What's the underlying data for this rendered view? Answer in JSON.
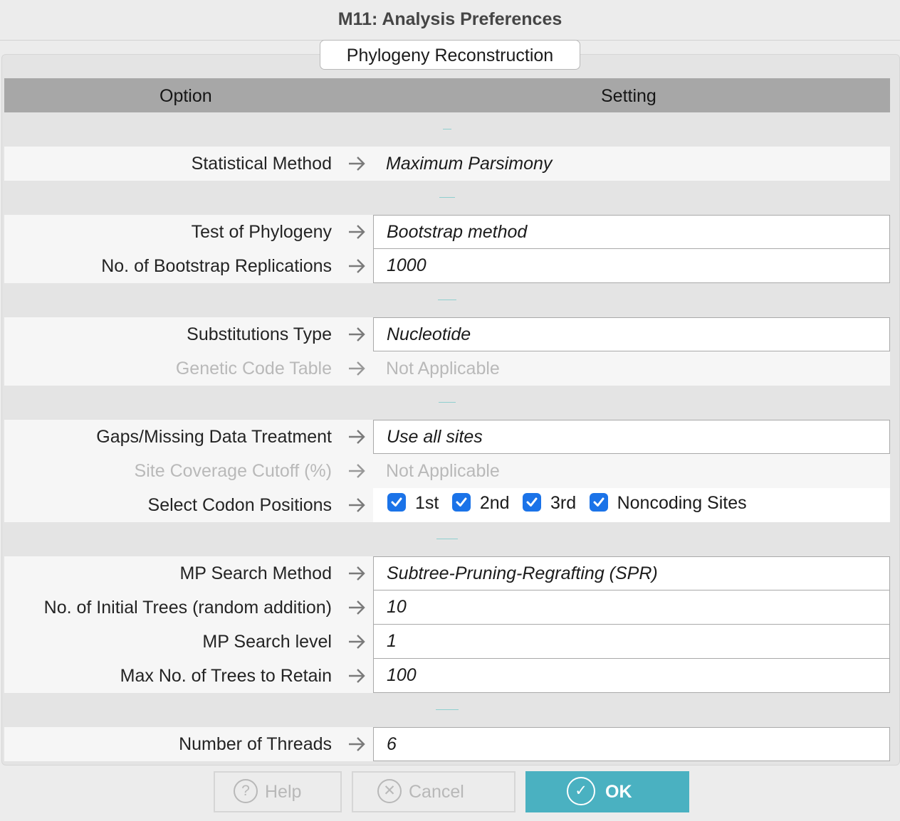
{
  "window": {
    "title": "M11: Analysis Preferences"
  },
  "tab": {
    "label": "Phylogeny Reconstruction"
  },
  "table": {
    "header_option": "Option",
    "header_setting": "Setting"
  },
  "rows": {
    "statistical_method": {
      "label": "Statistical Method",
      "value": "Maximum Parsimony"
    },
    "test_of_phylogeny": {
      "label": "Test of Phylogeny",
      "value": "Bootstrap method"
    },
    "bootstrap_replications": {
      "label": "No. of Bootstrap Replications",
      "value": "1000"
    },
    "substitutions_type": {
      "label": "Substitutions Type",
      "value": "Nucleotide"
    },
    "genetic_code_table": {
      "label": "Genetic Code Table",
      "value": "Not Applicable"
    },
    "gaps_missing": {
      "label": "Gaps/Missing Data Treatment",
      "value": "Use all sites"
    },
    "site_coverage": {
      "label": "Site Coverage Cutoff (%)",
      "value": "Not Applicable"
    },
    "codon_positions": {
      "label": "Select Codon Positions"
    },
    "mp_search_method": {
      "label": "MP Search Method",
      "value": "Subtree-Pruning-Regrafting (SPR)"
    },
    "initial_trees": {
      "label": "No. of Initial Trees (random addition)",
      "value": "10"
    },
    "mp_search_level": {
      "label": "MP Search level",
      "value": "1"
    },
    "max_trees": {
      "label": "Max No. of Trees to Retain",
      "value": "100"
    },
    "threads": {
      "label": "Number of Threads",
      "value": "6"
    }
  },
  "codon_options": {
    "first": {
      "label": "1st",
      "checked": true
    },
    "second": {
      "label": "2nd",
      "checked": true
    },
    "third": {
      "label": "3rd",
      "checked": true
    },
    "noncoding": {
      "label": "Noncoding Sites",
      "checked": true
    }
  },
  "buttons": {
    "help": "Help",
    "cancel": "Cancel",
    "ok": "OK"
  },
  "colors": {
    "accent": "#4ab1c1",
    "checkbox": "#1b73e8",
    "header_bg": "#a7a7a7"
  }
}
